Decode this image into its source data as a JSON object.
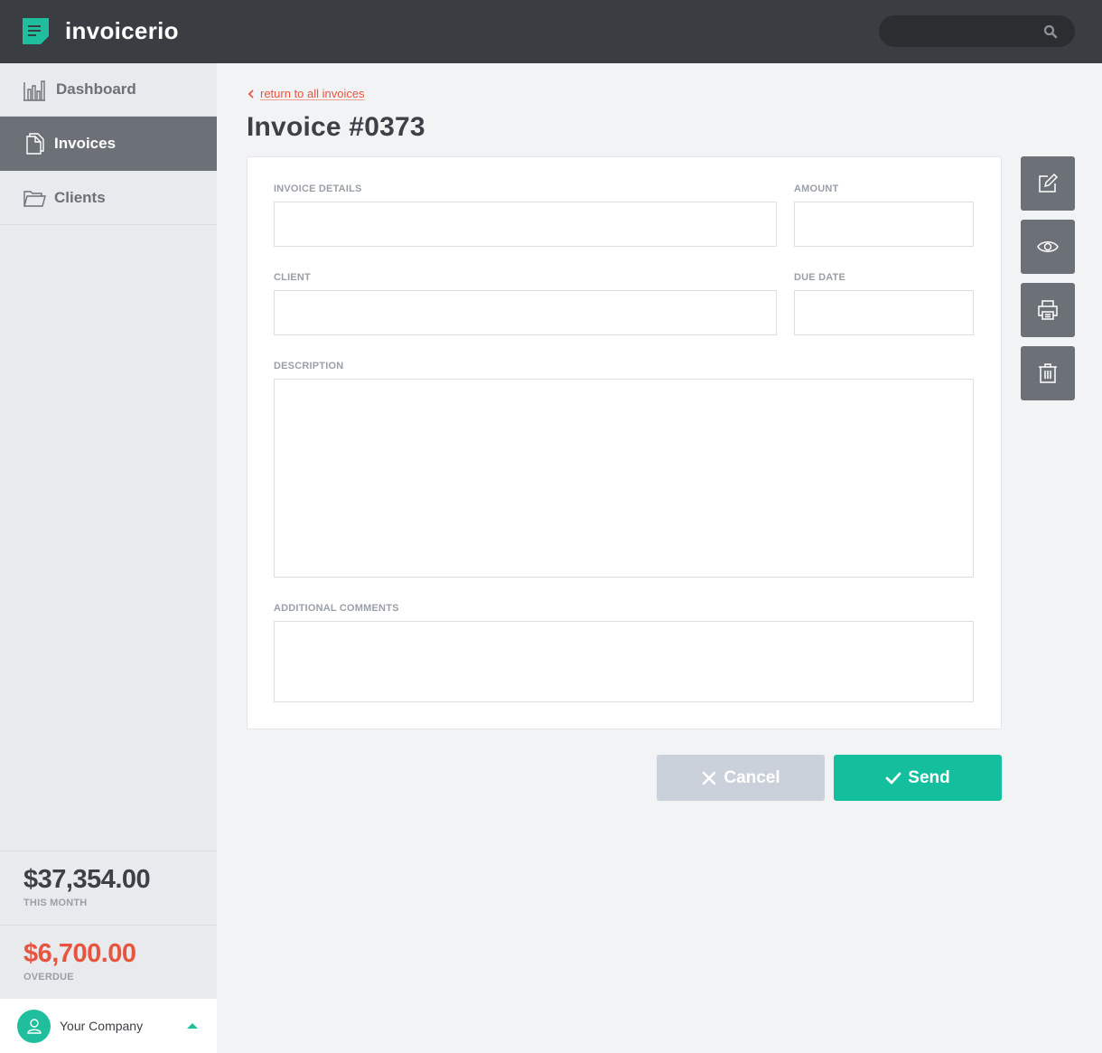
{
  "app": {
    "name": "invoicerio",
    "brand_color": "#1fbf9d",
    "accent_red": "#e8553f"
  },
  "search": {
    "placeholder": "",
    "icon": "search-icon"
  },
  "sidebar": {
    "items": [
      {
        "label": "Dashboard",
        "icon": "bar-chart-icon",
        "active": false
      },
      {
        "label": "Invoices",
        "icon": "documents-icon",
        "active": true
      },
      {
        "label": "Clients",
        "icon": "folder-icon",
        "active": false
      }
    ],
    "stats": [
      {
        "value": "$37,354.00",
        "label": "THIS MONTH",
        "color": "#3d4046"
      },
      {
        "value": "$6,700.00",
        "label": "OVERDUE",
        "color": "#e8553f"
      }
    ],
    "company": {
      "name": "Your Company",
      "icon": "user-icon"
    }
  },
  "main": {
    "back_link": "return to all invoices",
    "title": "Invoice #0373",
    "form": {
      "invoice_details": {
        "label": "INVOICE DETAILS",
        "value": ""
      },
      "amount": {
        "label": "AMOUNT",
        "value": ""
      },
      "client": {
        "label": "CLIENT",
        "value": ""
      },
      "due_date": {
        "label": "DUE DATE",
        "value": ""
      },
      "description": {
        "label": "DESCRIPTION",
        "value": ""
      },
      "comments": {
        "label": "ADDITIONAL COMMENTS",
        "value": ""
      }
    },
    "actions": [
      "edit-icon",
      "eye-icon",
      "printer-icon",
      "trash-icon"
    ],
    "buttons": {
      "cancel": "Cancel",
      "send": "Send"
    }
  }
}
